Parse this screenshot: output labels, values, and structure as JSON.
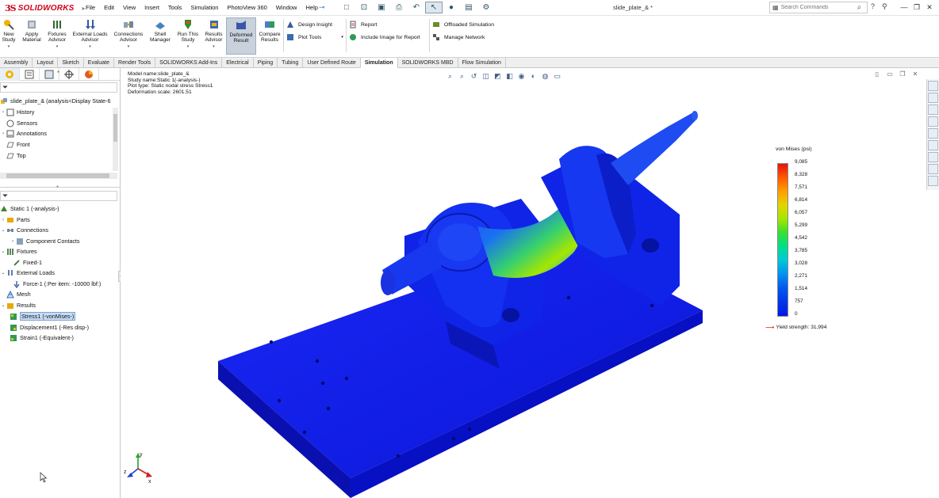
{
  "app": {
    "logo_ds": "3S",
    "logo": "SOLIDWORKS",
    "document_title": "slide_plate_&  *",
    "menus": [
      "File",
      "Edit",
      "View",
      "Insert",
      "Tools",
      "Simulation",
      "PhotoView 360",
      "Window",
      "Help"
    ],
    "search_placeholder": "Search Commands"
  },
  "ribbon": {
    "buttons": [
      {
        "label1": "New",
        "label2": "Study",
        "icon": "new-study-icon"
      },
      {
        "label1": "Apply",
        "label2": "Material",
        "icon": "apply-material-icon"
      },
      {
        "label1": "Fixtures",
        "label2": "Advisor",
        "icon": "fixtures-icon"
      },
      {
        "label1": "External Loads",
        "label2": "Advisor",
        "icon": "external-loads-icon"
      },
      {
        "label1": "Connections",
        "label2": "Advisor",
        "icon": "connections-icon"
      },
      {
        "label1": "Shell",
        "label2": "Manager",
        "icon": "shell-icon"
      },
      {
        "label1": "Run This",
        "label2": "Study",
        "icon": "run-study-icon"
      },
      {
        "label1": "Results",
        "label2": "Advisor",
        "icon": "results-advisor-icon"
      },
      {
        "label1": "Deformed",
        "label2": "Result",
        "icon": "deformed-result-icon"
      },
      {
        "label1": "Compare",
        "label2": "Results",
        "icon": "compare-results-icon"
      }
    ],
    "small": {
      "design_insight": "Design Insight",
      "plot_tools": "Plot Tools",
      "report": "Report",
      "include_image": "Include Image for Report",
      "offloaded": "Offloaded Simulation",
      "manage_network": "Manage Network"
    }
  },
  "tabs": [
    "Assembly",
    "Layout",
    "Sketch",
    "Evaluate",
    "Render Tools",
    "SOLIDWORKS Add-Ins",
    "Electrical",
    "Piping",
    "Tubing",
    "User Defined Route",
    "Simulation",
    "SOLIDWORKS MBD",
    "Flow Simulation"
  ],
  "active_tab": "Simulation",
  "feature_tree": {
    "root": "slide_plate_& (analysis<Display State-6",
    "items": [
      "History",
      "Sensors",
      "Annotations",
      "Front",
      "Top"
    ]
  },
  "sim_tree": {
    "study": "Static 1 (-analysis-)",
    "parts": "Parts",
    "connections": "Connections",
    "component_contacts": "Component Contacts",
    "fixtures": "Fixtures",
    "fixed1": "Fixed-1",
    "external_loads": "External Loads",
    "force1": "Force-1 (:Per item: -10000 lbf:)",
    "mesh": "Mesh",
    "results": "Results",
    "stress1": "Stress1 (-vonMises-)",
    "displacement1": "Displacement1 (-Res disp-)",
    "strain1": "Strain1 (-Equivalent-)"
  },
  "viewport_info": {
    "model_name": "Model name:slide_plate_&",
    "study_name": "Study name:Static 1(-analysis-)",
    "plot_type": "Plot type: Static nodal stress Stress1",
    "deformation_scale": "Deformation scale: 2601.51"
  },
  "legend": {
    "title": "von Mises (psi)",
    "ticks": [
      "9,085",
      "8,328",
      "7,571",
      "6,814",
      "6,057",
      "5,299",
      "4,542",
      "3,785",
      "3,028",
      "2,271",
      "1,514",
      "757",
      "0"
    ],
    "yield": "Yield strength: 31,994"
  },
  "colors": {
    "plate": "#0a12e8",
    "stress_high": "#e3140d",
    "stress_mid": "#39e12c",
    "stress_low": "#0018e6",
    "brand": "#d0021b"
  }
}
